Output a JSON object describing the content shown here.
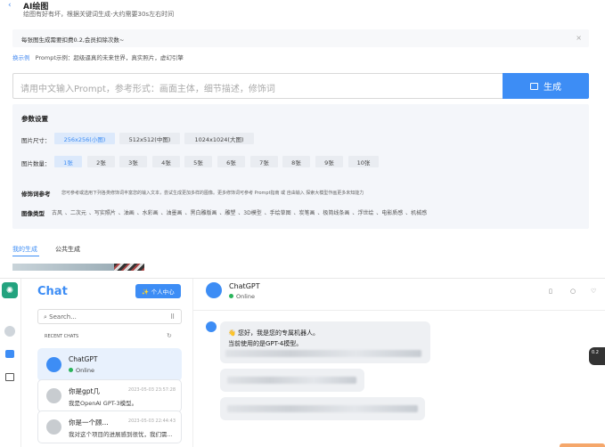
{
  "header": {
    "back_icon": "‹",
    "title": "AI绘图",
    "subtitle": "绘图有好有坏，根据关键词生成-大约需要30s左右时间"
  },
  "notice": {
    "text": "每张图生成需要扣费0.2,会员扣除次数~",
    "close": "×"
  },
  "example": {
    "label": "换示例",
    "text": "Prompt示例：超级逼真的未来世界，真实照片，虚幻引擎"
  },
  "prompt": {
    "placeholder": "请用中文输入Prompt，参考形式：画面主体，细节描述，修饰词",
    "button": "生成"
  },
  "params": {
    "title": "参数设置",
    "size_label": "图片尺寸：",
    "sizes": [
      "256x256(小图)",
      "512x512(中图)",
      "1024x1024(大图)"
    ],
    "count_label": "图片数量：",
    "counts": [
      "1张",
      "2张",
      "3张",
      "4张",
      "5张",
      "6张",
      "7张",
      "8张",
      "9张",
      "10张"
    ],
    "modifier_title": "修饰词参考",
    "modifier_text": "您可参考或选用下列各类修饰词丰富您的输入文本，尝试生成更加多样的图像。更多修饰词可参考 Prompt指南 或 自由输入 探索大模型作画更多未知能力",
    "style_title": "图像类型",
    "styles": "古风 、二次元 、写实照片 、油画 、水彩画 、油墨画 、黑白雕版画 、雕塑 、3D模型 、手绘草图 、炭笔画 、极简线条画 、浮世绘 、电影质感 、机械感"
  },
  "tabs": [
    "我的生成",
    "公共生成"
  ],
  "chat": {
    "logo_icon": "✺",
    "title": "Chat",
    "center_button": "✨ 个人中心",
    "search_placeholder": "Search...",
    "recent_label": "RECENT CHATS",
    "items": [
      {
        "name": "ChatGPT",
        "status": "Online",
        "time": ""
      },
      {
        "name": "你是gpt几",
        "sub": "我是OpenAI GPT-3模型。",
        "time": "2023-05-03 23:57:28"
      },
      {
        "name": "你是一个顾...",
        "sub": "我对这个项目的进展感到很忧，我们需...",
        "time": "2023-05-03 22:44:43"
      }
    ],
    "main_name": "ChatGPT",
    "main_status": "Online",
    "msg1_line1": "👋 您好，我是您的专属机器人。",
    "msg1_line2": "当前使用的是GPT-4模型。",
    "side_label": "0.2"
  },
  "colors": {
    "accent": "#3d8df5",
    "online": "#2ab45b",
    "logo": "#23a37f"
  }
}
